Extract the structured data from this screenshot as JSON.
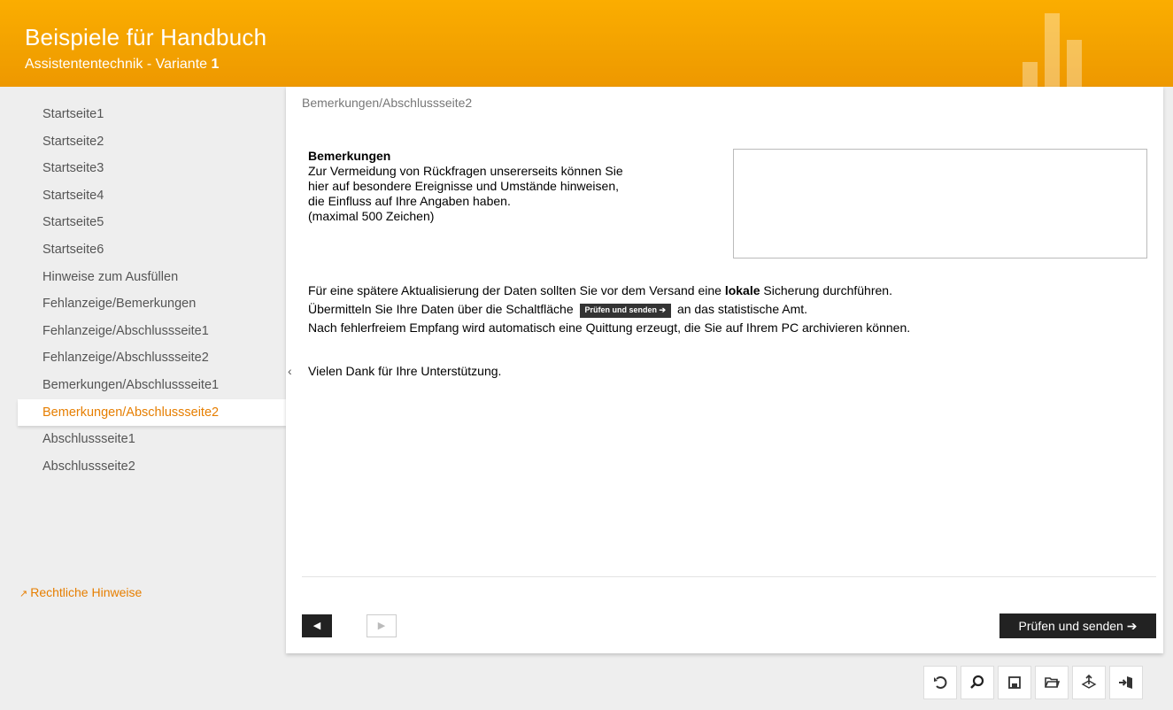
{
  "header": {
    "title": "Beispiele für Handbuch",
    "subtitle_prefix": "Assistententechnik - Variante ",
    "subtitle_variant": "1"
  },
  "sidebar": {
    "items": [
      {
        "label": "Startseite1",
        "active": false
      },
      {
        "label": "Startseite2",
        "active": false
      },
      {
        "label": "Startseite3",
        "active": false
      },
      {
        "label": "Startseite4",
        "active": false
      },
      {
        "label": "Startseite5",
        "active": false
      },
      {
        "label": "Startseite6",
        "active": false
      },
      {
        "label": "Hinweise zum Ausfüllen",
        "active": false
      },
      {
        "label": "Fehlanzeige/Bemerkungen",
        "active": false
      },
      {
        "label": "Fehlanzeige/Abschlussseite1",
        "active": false
      },
      {
        "label": "Fehlanzeige/Abschlussseite2",
        "active": false
      },
      {
        "label": "Bemerkungen/Abschlussseite1",
        "active": false
      },
      {
        "label": "Bemerkungen/Abschlussseite2",
        "active": true
      },
      {
        "label": "Abschlussseite1",
        "active": false
      },
      {
        "label": "Abschlussseite2",
        "active": false
      }
    ],
    "legal_link": "Rechtliche Hinweise",
    "collapse_glyph": "‹"
  },
  "main": {
    "breadcrumb": "Bemerkungen/Abschlussseite2",
    "remarks": {
      "heading": "Bemerkungen",
      "line1": "Zur Vermeidung von Rückfragen unsererseits können Sie",
      "line2": "hier auf besondere Ereignisse und Umstände hinweisen,",
      "line3": "die Einfluss auf Ihre Angaben haben.",
      "line4": "(maximal 500 Zeichen)",
      "value": ""
    },
    "info": {
      "line1_pre": "Für eine spätere Aktualisierung der Daten sollten Sie vor dem Versand eine ",
      "line1_bold": "lokale",
      "line1_post": " Sicherung durchführen.",
      "line2_pre": "Übermitteln Sie Ihre Daten über die Schaltfläche",
      "line2_button": "Prüfen und senden ➔",
      "line2_post": "an das statistische Amt.",
      "line3": "Nach fehlerfreiem Empfang wird automatisch eine Quittung erzeugt, die Sie auf Ihrem PC archivieren können."
    },
    "thanks": "Vielen Dank für Ihre Unterstützung.",
    "nav": {
      "prev_glyph": "◀",
      "next_glyph": "▶",
      "send_label": "Prüfen und senden ➔"
    }
  },
  "toolbar": {
    "icons": [
      "undo-icon",
      "search-icon",
      "save-icon",
      "open-folder-icon",
      "transfer-icon",
      "exit-icon"
    ]
  },
  "colors": {
    "header": "#f3a200",
    "accent": "#e67e00",
    "button_dark": "#222222"
  }
}
